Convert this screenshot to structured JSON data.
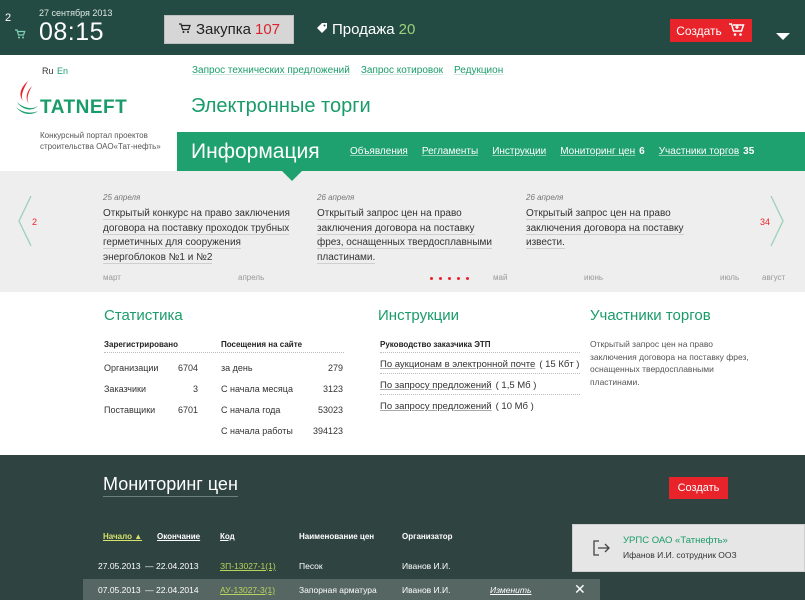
{
  "topbar": {
    "badge": "2",
    "date": "27 сентября 2013",
    "time": "08:15",
    "purchase_label": "Закупка",
    "purchase_count": "107",
    "sale_label": "Продажа",
    "sale_count": "20",
    "create_label": "Создать"
  },
  "header": {
    "lang_ru": "Ru",
    "lang_en": "En",
    "logo_text": "TATNEFT",
    "portal_desc": "Конкурсный портал проектов строительства ОАО«Тат-нефть»",
    "links": [
      "Запрос технических предложений",
      "Запрос котировок",
      "Редукцион"
    ],
    "site_title": "Электронные торги"
  },
  "infobar": {
    "title": "Информация",
    "nav": [
      {
        "label": "Объявления",
        "count": ""
      },
      {
        "label": "Регламенты",
        "count": ""
      },
      {
        "label": "Инструкции",
        "count": ""
      },
      {
        "label": "Мониторинг цен",
        "count": "6"
      },
      {
        "label": "Участники торгов",
        "count": "35"
      }
    ]
  },
  "carousel": {
    "left_num": "2",
    "right_num": "34",
    "news": [
      {
        "date": "25 апреля",
        "text": "Открытый конкурс на право заключения договора на поставку проходок трубных герметичных для сооружения энергоблоков №1 и №2"
      },
      {
        "date": "26 апреля",
        "text": "Открытый запрос цен на право заключения договора на поставку фрез, оснащенных твердосплавными пластинами."
      },
      {
        "date": "26 апреля",
        "text": "Открытый запрос цен на право заключения договора на поставку извести."
      }
    ],
    "timeline": [
      "март",
      "апрель",
      "май",
      "июнь",
      "июль",
      "август"
    ]
  },
  "stats": {
    "title": "Статистика",
    "registered_label": "Зарегистрировано",
    "visits_label": "Посещения на сайте",
    "registered": [
      {
        "label": "Организации",
        "value": "6704"
      },
      {
        "label": "Заказчики",
        "value": "3"
      },
      {
        "label": "Поставщики",
        "value": "6701"
      }
    ],
    "visits": [
      {
        "label": "за день",
        "value": "279"
      },
      {
        "label": "С начала месяца",
        "value": "3123"
      },
      {
        "label": "С начала года",
        "value": "53023"
      },
      {
        "label": "С начала работы",
        "value": "394123"
      }
    ]
  },
  "instructions": {
    "title": "Инструкции",
    "head": "Руководство заказчика ЭТП",
    "links": [
      {
        "label": "По аукционам в электронной почте",
        "size": "( 15 Кбт )"
      },
      {
        "label": "По запросу предложений",
        "size": "( 1,5 Мб )"
      },
      {
        "label": "По запросу предложений",
        "size": "( 10 Мб )"
      }
    ]
  },
  "participants": {
    "title": "Участники торгов",
    "text": "Открытый запрос цен на право заключения договора на поставку фрез, оснащенных твердосплавными пластинами."
  },
  "monitoring": {
    "title": "Мониторинг цен",
    "create_label": "Создать",
    "columns": {
      "start": "Начало ▲",
      "end": "Окончание",
      "code": "Код",
      "name": "Наименование цен",
      "org": "Организатор"
    },
    "rows": [
      {
        "start": "27.05.2013",
        "end": "22.04.2013",
        "code": "ЗП-13027-1(1)",
        "name": "Песок",
        "org": "Иванов И.И.",
        "edit": ""
      },
      {
        "start": "07.05.2013",
        "end": "22.04.2014",
        "code": "АУ-13027-3(1)",
        "name": "Запорная арматура",
        "org": "Иванов И.И.",
        "edit": "Изменить"
      }
    ]
  },
  "user": {
    "org": "УРПС ОАО «Татнефть»",
    "name": "Ифанов И.И. сотрудник ООЗ"
  },
  "colors": {
    "brand_green": "#1fa06f",
    "dark_header": "#244b43",
    "accent_red": "#e8232a"
  }
}
